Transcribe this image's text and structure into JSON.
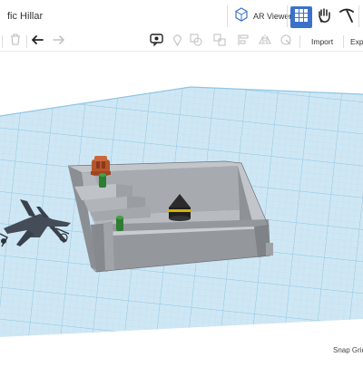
{
  "header": {
    "title": "fic Hillar",
    "ar_viewer_label": "AR Viewer",
    "view_mode": "grid"
  },
  "toolbar": {
    "import_label": "Import",
    "export_label": "Expo"
  },
  "workplane": {
    "snap_grid_label": "Snap Grid"
  },
  "colors": {
    "accent": "#3b72c9",
    "workplane": "#cfe7f4",
    "grid_line": "#a9d4ea",
    "wall": "#9a9ea3",
    "terrain_green": "#2e7d32",
    "building_orange": "#b5542b"
  }
}
